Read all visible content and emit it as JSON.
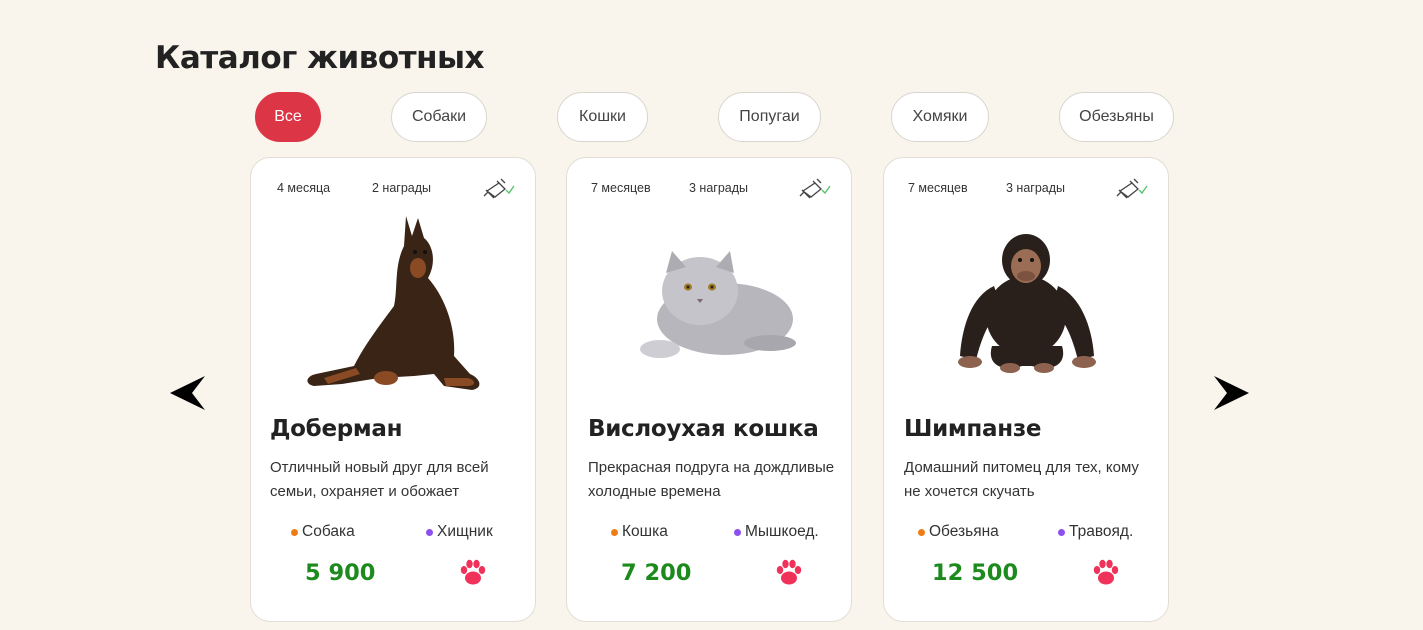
{
  "page": {
    "title": "Каталог животных"
  },
  "filters": [
    {
      "label": "Все",
      "active": true
    },
    {
      "label": "Собаки",
      "active": false
    },
    {
      "label": "Кошки",
      "active": false
    },
    {
      "label": "Попугаи",
      "active": false
    },
    {
      "label": "Хомяки",
      "active": false
    },
    {
      "label": "Обезьяны",
      "active": false
    }
  ],
  "colors": {
    "background": "#f9f4ec",
    "accent": "#dc3545",
    "price": "#1c8a1c",
    "paw": "#f0325a",
    "type_dot": "#f07d14",
    "diet_dot": "#8e4ff0",
    "vaccine_check": "#5cc46a"
  },
  "icons": {
    "prev": "arrow-left-icon",
    "next": "arrow-right-icon",
    "vaccine": "syringe-check-icon",
    "favorite": "paw-icon"
  },
  "cards": [
    {
      "age": "4 месяца",
      "awards": "2 награды",
      "name": "Доберман",
      "description": "Отличный новый друг для всей семьи, охраняет и обожает",
      "type": "Собака",
      "diet": "Хищник",
      "price": "5 900",
      "image": "doberman"
    },
    {
      "age": "7 месяцев",
      "awards": "3 награды",
      "name": "Вислоухая кошка",
      "description": "Прекрасная подруга на дождливые холодные времена",
      "type": "Кошка",
      "diet": "Мышкоед.",
      "price": "7 200",
      "image": "cat"
    },
    {
      "age": "7 месяцев",
      "awards": "3 награды",
      "name": "Шимпанзе",
      "description": "Домашний питомец для тех, кому не хочется скучать",
      "type": "Обезьяна",
      "diet": "Травояд.",
      "price": "12 500",
      "image": "chimpanzee"
    }
  ]
}
